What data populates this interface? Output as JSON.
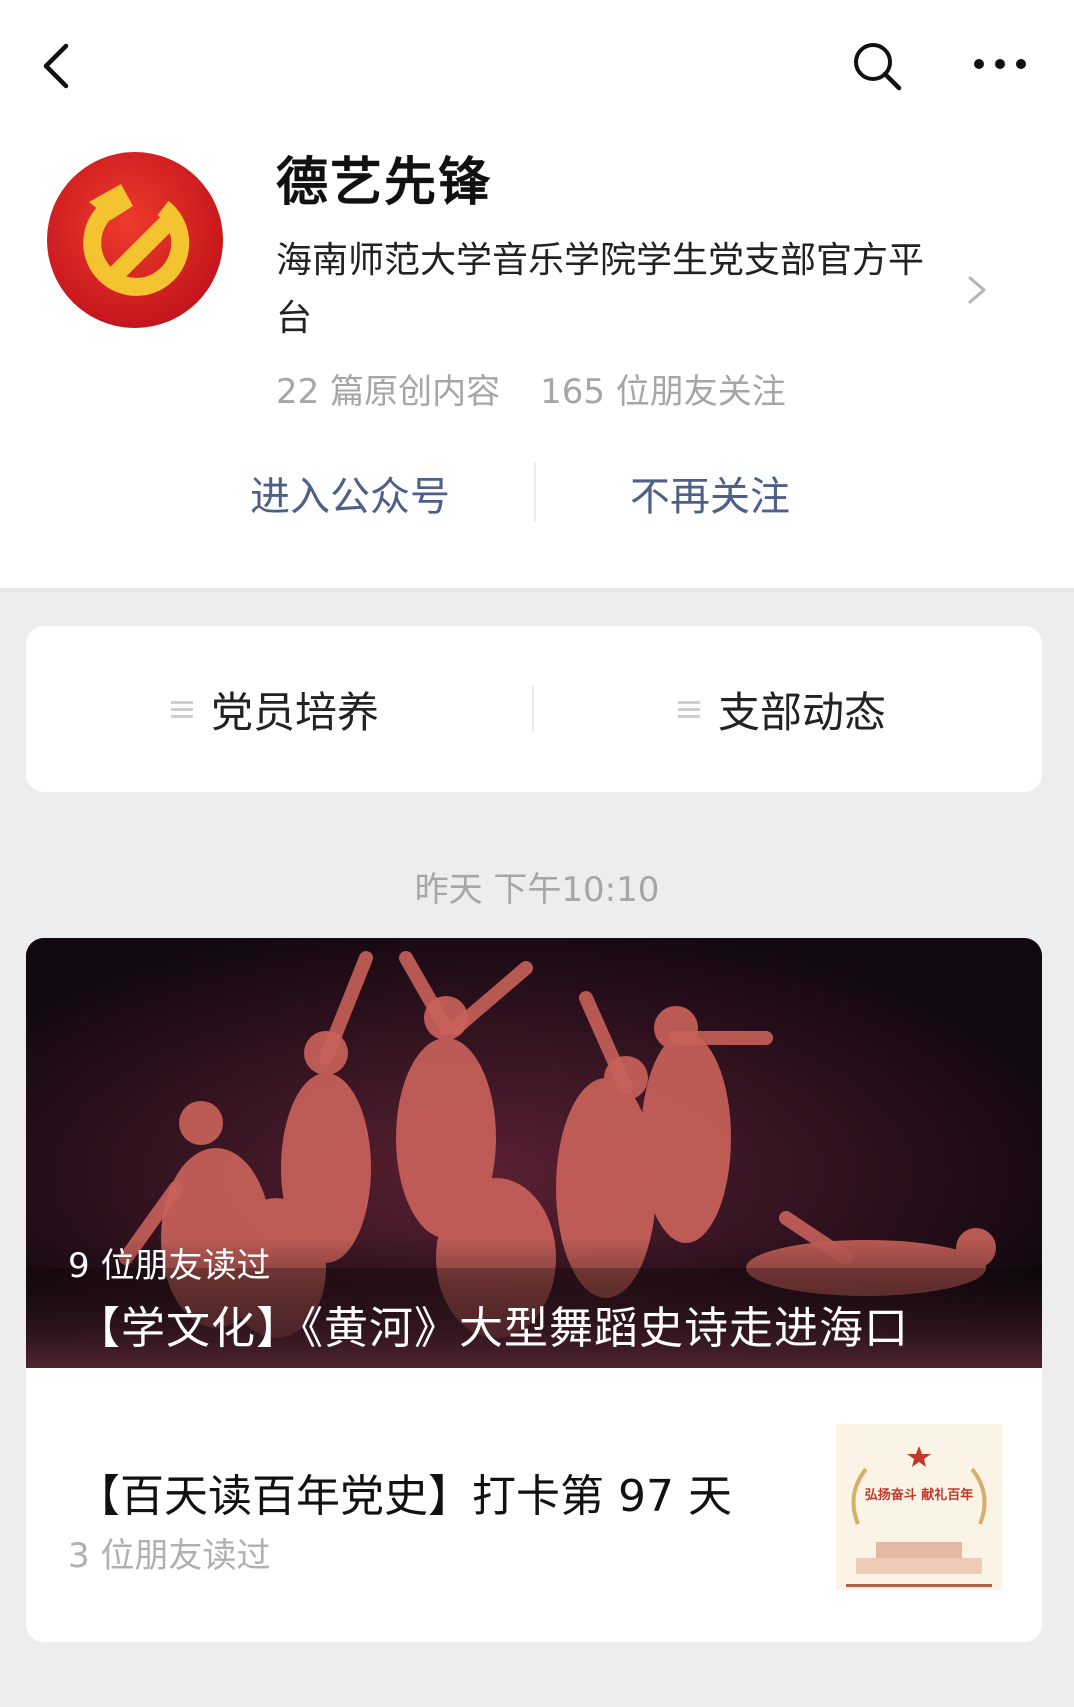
{
  "account": {
    "name": "德艺先锋",
    "description": "海南师范大学音乐学院学生党支部官方平台",
    "original_count": "22 篇原创内容",
    "followers": "165 位朋友关注"
  },
  "actions": {
    "enter": "进入公众号",
    "unfollow": "不再关注"
  },
  "menu": [
    {
      "label": "党员培养"
    },
    {
      "label": "支部动态"
    }
  ],
  "timestamp": "昨天 下午10:10",
  "articles": [
    {
      "title": "【学文化】《黄河》大型舞蹈史诗走进海口",
      "reads": "9 位朋友读过"
    },
    {
      "title": "【百天读百年党史】打卡第 97 天",
      "reads": "3 位朋友读过",
      "thumb_text": "弘扬奋斗 献礼百年"
    }
  ],
  "icons": {
    "back": "back-arrow-icon",
    "search": "search-icon",
    "more": "more-dots-icon",
    "chevron": "chevron-right-icon",
    "menu": "menu-lines-icon"
  },
  "colors": {
    "link": "#4f6088",
    "muted": "#a6a6a6",
    "avatar_red": "#d7261e",
    "avatar_gold": "#f4c430"
  }
}
